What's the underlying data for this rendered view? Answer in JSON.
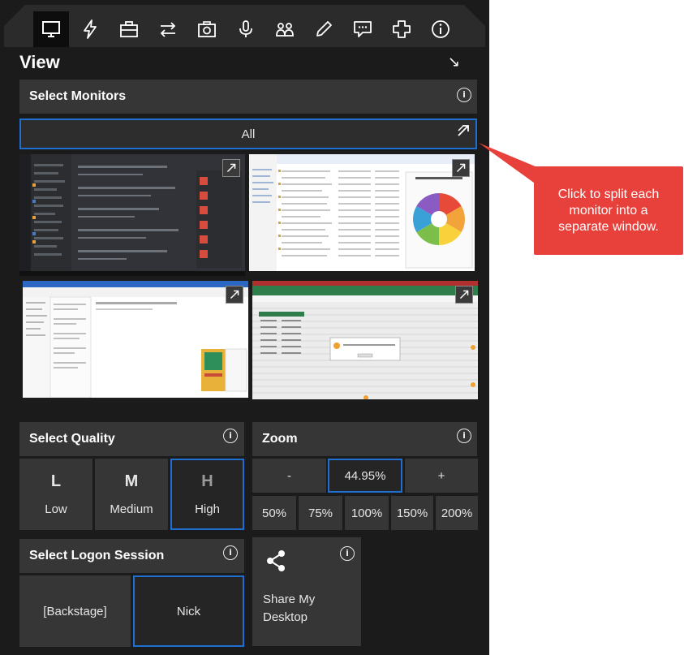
{
  "toolbar": {
    "icons": [
      "monitor-icon",
      "lightning-icon",
      "briefcase-icon",
      "transfer-arrows-icon",
      "camera-icon",
      "microphone-icon",
      "users-icon",
      "pencil-icon",
      "chat-icon",
      "plus-cross-icon",
      "info-icon"
    ],
    "active": "monitor-icon"
  },
  "view": {
    "title": "View",
    "collapse_glyph": "↘"
  },
  "monitors": {
    "title": "Select Monitors",
    "all_label": "All"
  },
  "quality": {
    "title": "Select Quality",
    "options": [
      {
        "letter": "L",
        "name": "Low"
      },
      {
        "letter": "M",
        "name": "Medium"
      },
      {
        "letter": "H",
        "name": "High"
      }
    ],
    "selected": "High"
  },
  "zoom": {
    "title": "Zoom",
    "minus": "-",
    "value": "44.95%",
    "plus": "+",
    "presets": [
      "50%",
      "75%",
      "100%",
      "150%",
      "200%"
    ]
  },
  "session": {
    "title": "Select Logon Session",
    "options": [
      "[Backstage]",
      "Nick"
    ],
    "selected": "Nick"
  },
  "share": {
    "label_line1": "Share My",
    "label_line2": "Desktop"
  },
  "callout": {
    "text": "Click to split each monitor into a separate window."
  },
  "colors": {
    "accent": "#1e6fd0",
    "callout": "#e8403a",
    "panel": "#1b1b1b",
    "tile": "#363636"
  }
}
